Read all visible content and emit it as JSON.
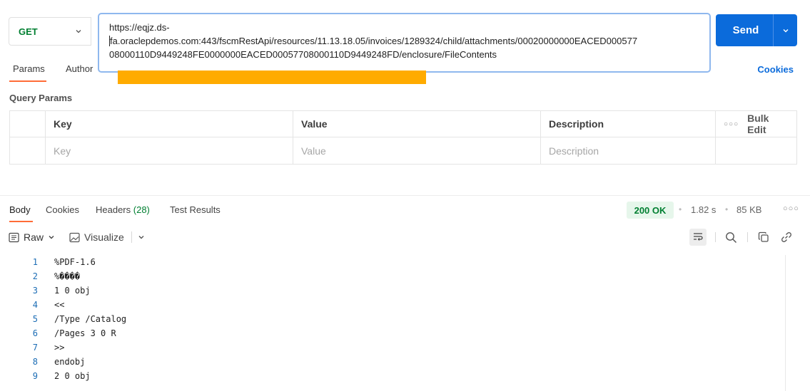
{
  "request": {
    "method": "GET",
    "url_line1": "https://eqjz.ds-",
    "url_line2": "fa.oraclepdemos.com:443/fscmRestApi/resources/11.13.18.05/invoices/1289324/child/attachments/00020000000EACED000577",
    "url_line3": "08000110D9449248FE0000000EACED00057708000110D9449248FD/enclosure/FileContents",
    "send_label": "Send"
  },
  "request_tabs": {
    "params": "Params",
    "auth": "Author",
    "cookies": "Cookies"
  },
  "query_params": {
    "section_label": "Query Params",
    "headers": [
      "Key",
      "Value",
      "Description"
    ],
    "bulk_edit": "Bulk Edit",
    "placeholders": [
      "Key",
      "Value",
      "Description"
    ]
  },
  "response": {
    "tabs": {
      "body": "Body",
      "cookies": "Cookies",
      "headers_label": "Headers",
      "headers_count": "(28)",
      "test_results": "Test Results"
    },
    "status": "200 OK",
    "time": "1.82 s",
    "size": "85 KB",
    "view_mode": "Raw",
    "visualize": "Visualize",
    "lines": [
      {
        "n": "1",
        "t": "%PDF-1.6"
      },
      {
        "n": "2",
        "t": "%����"
      },
      {
        "n": "3",
        "t": "1 0 obj"
      },
      {
        "n": "4",
        "t": "<<"
      },
      {
        "n": "5",
        "t": "/Type /Catalog"
      },
      {
        "n": "6",
        "t": "/Pages 3 0 R"
      },
      {
        "n": "7",
        "t": ">>"
      },
      {
        "n": "8",
        "t": "endobj"
      },
      {
        "n": "9",
        "t": "2 0 obj"
      }
    ]
  },
  "colors": {
    "accent": "#0b6bdb",
    "tab_underline": "#ff6c37",
    "method_get": "#007f31",
    "highlight": "#ffab00",
    "status_ok_bg": "#e6f6eb"
  }
}
